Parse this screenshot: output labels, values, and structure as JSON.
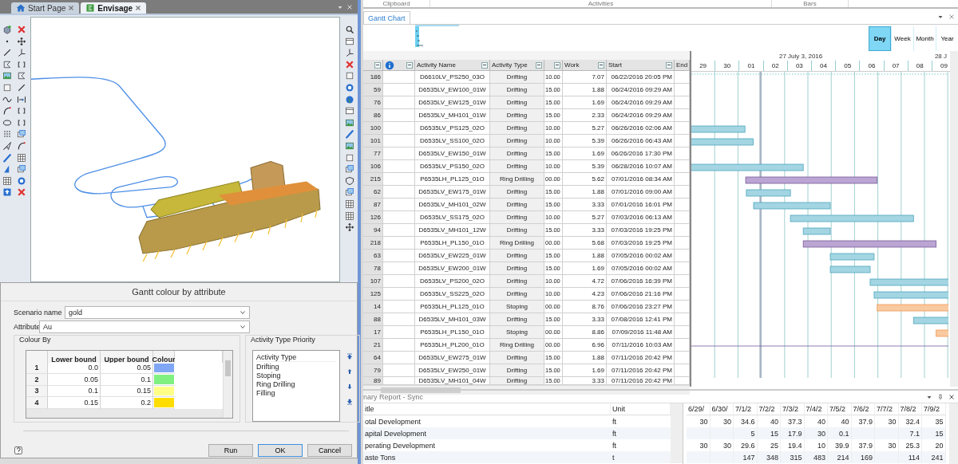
{
  "ribbon": {
    "groups": [
      "Clipboard",
      "Activities",
      "Bars"
    ]
  },
  "left_panel": {
    "tabs": [
      {
        "label": "Start Page",
        "selected": false
      },
      {
        "label": "Envisage",
        "selected": true
      }
    ]
  },
  "dialog": {
    "title": "Gantt colour by attribute",
    "scenario_label": "Scenario name",
    "scenario_value": "gold",
    "attribute_label": "Attribute",
    "attribute_value": "Au",
    "colour_by": {
      "legend": "Colour By",
      "columns": [
        "Lower bound",
        "Upper bound",
        "Colour"
      ],
      "rows": [
        {
          "index": "1",
          "lower": "0.0",
          "upper": "0.05",
          "color": "#7fa7f5"
        },
        {
          "index": "2",
          "lower": "0.05",
          "upper": "0.1",
          "color": "#80f080"
        },
        {
          "index": "3",
          "lower": "0.1",
          "upper": "0.15",
          "color": "#ffff88"
        },
        {
          "index": "4",
          "lower": "0.15",
          "upper": "0.2",
          "color": "#ffdd00"
        }
      ]
    },
    "priority": {
      "legend": "Activity Type Priority",
      "header": "Activity Type",
      "items": [
        "Drifting",
        "Stoping",
        "Ring Drilling",
        "Filling"
      ]
    },
    "buttons": [
      {
        "label": "Run",
        "default": false
      },
      {
        "label": "OK",
        "default": true
      },
      {
        "label": "Cancel",
        "default": false
      }
    ]
  },
  "gantt": {
    "tab": "Gantt Chart",
    "view_buttons": [
      {
        "label": "Day",
        "selected": true
      },
      {
        "label": "Week",
        "selected": false
      },
      {
        "label": "Month",
        "selected": false
      },
      {
        "label": "Year",
        "selected": false
      }
    ],
    "table": {
      "columns": [
        "Activity Name",
        "Activity Type",
        "Work",
        "Start",
        "End"
      ],
      "rows": [
        {
          "id": "186",
          "name": "D6610LV_PS250_03O",
          "type": "Drifting",
          "column_5": "10.00",
          "work": "7.07",
          "start": "06/22/2016 20:05 PM"
        },
        {
          "id": "59",
          "name": "D6535LV_EW100_01W",
          "type": "Drifting",
          "column_5": "15.00",
          "work": "1.88",
          "start": "06/24/2016 09:29 AM"
        },
        {
          "id": "76",
          "name": "D6535LV_EW125_01W",
          "type": "Drifting",
          "column_5": "15.00",
          "work": "1.69",
          "start": "06/24/2016 09:29 AM"
        },
        {
          "id": "86",
          "name": "D6535LV_MH101_01W",
          "type": "Drifting",
          "column_5": "15.00",
          "work": "2.33",
          "start": "06/24/2016 09:29 AM"
        },
        {
          "id": "100",
          "name": "D6535LV_PS125_02O",
          "type": "Drifting",
          "column_5": "10.00",
          "work": "5.27",
          "start": "06/26/2016 02:06 AM",
          "kind": "drifting"
        },
        {
          "id": "101",
          "name": "D6535LV_SS100_02O",
          "type": "Drifting",
          "column_5": "10.00",
          "work": "5.39",
          "start": "06/26/2016 06:43 AM",
          "kind": "drifting"
        },
        {
          "id": "77",
          "name": "D6535LV_EW150_01W",
          "type": "Drifting",
          "column_5": "15.00",
          "work": "1.69",
          "start": "06/26/2016 17:30 PM"
        },
        {
          "id": "106",
          "name": "D6535LV_PS150_02O",
          "type": "Drifting",
          "column_5": "10.00",
          "work": "5.39",
          "start": "06/28/2016 10:07 AM",
          "kind": "drifting"
        },
        {
          "id": "215",
          "name": "P6535LH_PL125_01O",
          "type": "Ring Drilling",
          "column_5": "00.00",
          "work": "5.62",
          "start": "07/01/2016 08:34 AM",
          "kind": "ring_drilling"
        },
        {
          "id": "62",
          "name": "D6535LV_EW175_01W",
          "type": "Drifting",
          "column_5": "15.00",
          "work": "1.88",
          "start": "07/01/2016 09:00 AM",
          "kind": "drifting"
        },
        {
          "id": "87",
          "name": "D6535LV_MH101_02W",
          "type": "Drifting",
          "column_5": "15.00",
          "work": "3.33",
          "start": "07/01/2016 16:01 PM",
          "kind": "drifting"
        },
        {
          "id": "126",
          "name": "D6535LV_SS175_02O",
          "type": "Drifting",
          "column_5": "10.00",
          "work": "5.27",
          "start": "07/03/2016 06:13 AM",
          "kind": "drifting"
        },
        {
          "id": "94",
          "name": "D6535LV_MH101_12W",
          "type": "Drifting",
          "column_5": "15.00",
          "work": "3.33",
          "start": "07/03/2016 19:25 PM",
          "kind": "drifting"
        },
        {
          "id": "218",
          "name": "P6535LH_PL150_01O",
          "type": "Ring Drilling",
          "column_5": "00.00",
          "work": "5.68",
          "start": "07/03/2016 19:25 PM",
          "kind": "ring_drilling"
        },
        {
          "id": "63",
          "name": "D6535LV_EW225_01W",
          "type": "Drifting",
          "column_5": "15.00",
          "work": "1.88",
          "start": "07/05/2016 00:02 AM",
          "kind": "drifting"
        },
        {
          "id": "78",
          "name": "D6535LV_EW200_01W",
          "type": "Drifting",
          "column_5": "15.00",
          "work": "1.69",
          "start": "07/05/2016 00:02 AM",
          "kind": "drifting"
        },
        {
          "id": "107",
          "name": "D6535LV_PS200_02O",
          "type": "Drifting",
          "column_5": "10.00",
          "work": "4.72",
          "start": "07/06/2016 16:39 PM",
          "kind": "drifting"
        },
        {
          "id": "125",
          "name": "D6535LV_SS225_02O",
          "type": "Drifting",
          "column_5": "10.00",
          "work": "4.23",
          "start": "07/06/2016 21:16 PM",
          "kind": "drifting"
        },
        {
          "id": "14",
          "name": "P6535LH_PL125_01O",
          "type": "Stoping",
          "column_5": "00.00",
          "work": "8.76",
          "start": "07/06/2016 23:27 PM",
          "kind": "stoping"
        },
        {
          "id": "88",
          "name": "D6535LV_MH101_03W",
          "type": "Drifting",
          "column_5": "15.00",
          "work": "3.33",
          "start": "07/08/2016 12:41 PM",
          "kind": "drifting"
        },
        {
          "id": "17",
          "name": "P6535LH_PL150_01O",
          "type": "Stoping",
          "column_5": "00.00",
          "work": "8.86",
          "start": "07/09/2016 11:48 AM",
          "kind": "stoping"
        },
        {
          "id": "21",
          "name": "P6535LH_PL200_01O",
          "type": "Ring Drilling",
          "column_5": "00.00",
          "work": "6.96",
          "start": "07/11/2016 10:03 AM",
          "kind": "ring_drilling"
        },
        {
          "id": "64",
          "name": "D6535LV_EW275_01W",
          "type": "Drifting",
          "column_5": "15.00",
          "work": "1.88",
          "start": "07/11/2016 20:42 PM"
        },
        {
          "id": "79",
          "name": "D6535LV_EW250_01W",
          "type": "Drifting",
          "column_5": "15.00",
          "work": "1.69",
          "start": "07/11/2016 20:42 PM"
        },
        {
          "id": "89",
          "name": "D6535LV_MH101_04W",
          "type": "Drifting",
          "column_5": "15.00",
          "work": "3.33",
          "start": "07/11/2016 20:42 PM"
        }
      ]
    },
    "timeline": {
      "period": "27 July 3, 2016",
      "next_period": "28 J",
      "days": [
        "29",
        "30",
        "01",
        "02",
        "03",
        "04",
        "05",
        "06",
        "07",
        "08",
        "09"
      ]
    }
  },
  "summary_report": {
    "title": "nary Report - Sync",
    "columns": [
      "itle",
      "Unit"
    ],
    "date_columns": [
      "6/29/",
      "6/30/",
      "7/1/2",
      "7/2/2",
      "7/3/2",
      "7/4/2",
      "7/5/2",
      "7/6/2",
      "7/7/2",
      "7/8/2",
      "7/9/2"
    ],
    "rows": [
      {
        "title": "otal Development",
        "unit": "ft",
        "values": {
          "column_1": "30",
          "column_2": "30",
          "column_3": "34.6",
          "column_4": "40",
          "column_5": "37.3",
          "column_6": "40",
          "column_7": "40",
          "column_8": "37.9",
          "column_9": "30",
          "column_10": "32.4",
          "column_11": "35"
        }
      },
      {
        "title": "apital Development",
        "unit": "ft",
        "values": {
          "column_3": "5",
          "column_4": "15",
          "column_5": "17.9",
          "column_6": "30",
          "column_7": "0.1",
          "column_10": "7.1",
          "column_11": "15"
        }
      },
      {
        "title": "perating Development",
        "unit": "ft",
        "values": {
          "column_1": "30",
          "column_2": "30",
          "column_3": "29.6",
          "column_4": "25",
          "column_5": "19.4",
          "column_6": "10",
          "column_7": "39.9",
          "column_8": "37.9",
          "column_9": "30",
          "column_10": "25.3",
          "column_11": "20"
        }
      },
      {
        "title": "aste Tons",
        "unit": "t",
        "values": {
          "column_3": "147",
          "column_4": "348",
          "column_5": "315",
          "column_6": "483",
          "column_7": "214",
          "column_8": "169",
          "column_10": "114",
          "column_11": "241"
        }
      }
    ]
  }
}
